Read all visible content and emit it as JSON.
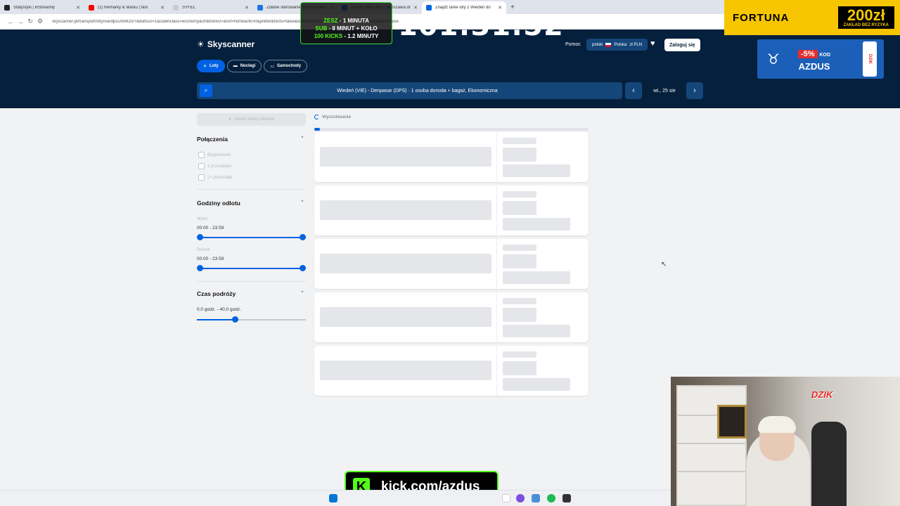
{
  "browser": {
    "tabs": [
      {
        "title": "Statystyki | inStreamly",
        "fav": "#222222"
      },
      {
        "title": "(2) Remarky & Maniu | fani",
        "fav": "#ff0000"
      },
      {
        "title": "SYFEL",
        "fav": "#cccccc"
      },
      {
        "title": "Zdalne sterowanie komputerem",
        "fav": "#1a73e8"
      },
      {
        "title": "Znajdź tanie loty z Warszawa do",
        "fav": "#0062e3"
      },
      {
        "title": "Znajdź tanie loty z Wiedeń do",
        "fav": "#0062e3"
      }
    ],
    "url": "skyscanner.pl/transport/loty/vie/dps/260825/?adultsv2=1&cabinclass=economy&childrenv2=&ref=home&rtn=0&preferdirects=false&outboundaltsenabled=false&inboundaltsenabled=false"
  },
  "header": {
    "logo": "Skyscanner",
    "help": "Pomoc",
    "locale_lang": "polski",
    "locale_country": "Polska",
    "locale_currency": "zł PLN",
    "login": "Zaloguj się",
    "pills": [
      "Loty",
      "Noclegi",
      "Samochody"
    ],
    "search_summary": "Wiedeń (VIE) - Denpasar (DPS) · 1 osoba dorosła + bagaż, Ekonomiczna",
    "date": "wt., 25 sie"
  },
  "filters": {
    "price_alert": "Utwórz alerty cenowe",
    "connections": {
      "title": "Połączenia",
      "options": [
        "Bezpośredni",
        "1 przesiadka",
        "2+ przesiadki"
      ]
    },
    "departure_times": {
      "title": "Godziny odlotu",
      "outbound_label": "Wylot",
      "outbound_range": "00:00 - 23:59",
      "return_label": "Powrót",
      "return_range": "00:00 - 23:59"
    },
    "duration": {
      "title": "Czas podróży",
      "range": "0,0 godz. - 40,0 godz.",
      "value_fraction": 0.35
    }
  },
  "results": {
    "status": "Wyszukiwanie",
    "progress": 0.02,
    "placeholder_cards": 5
  },
  "overlays": {
    "counter_lines": [
      {
        "label": "ZESZ",
        "value": " - 1 MINUTA"
      },
      {
        "label": "SUB",
        "value": " - 8 MINUT + KOŁO"
      },
      {
        "label": "100 KICKS",
        "value": " - 1.2 MINUTY"
      }
    ],
    "timer": "101:31:52",
    "fortuna_brand": "FORTUNA",
    "fortuna_amount": "200zł",
    "fortuna_sub": "ZAKŁAD BEZ RYZYKA",
    "azdus_discount": "-5%",
    "azdus_kod": "KOD",
    "azdus_code": "AZDUS",
    "dzik": "DZIK",
    "kick_url": "kick.com/azdus",
    "kick_letter": "K"
  }
}
